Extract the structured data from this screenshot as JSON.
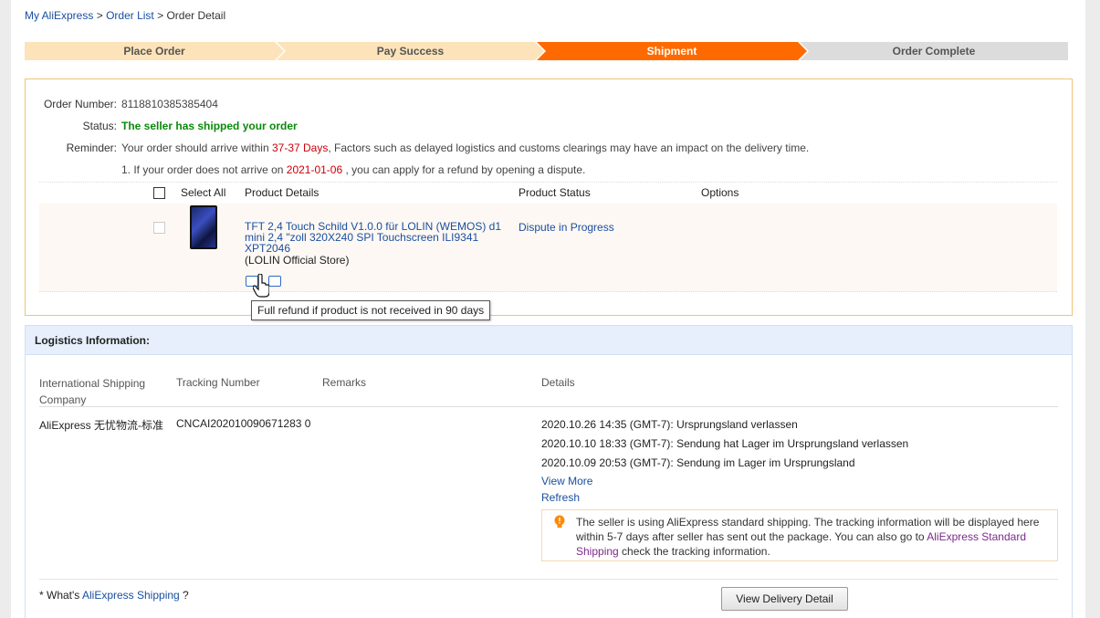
{
  "breadcrumb": {
    "home": "My AliExpress",
    "sep1": ">",
    "list": "Order List",
    "sep2": ">",
    "current": "Order Detail"
  },
  "steps": [
    "Place Order",
    "Pay Success",
    "Shipment",
    "Order Complete"
  ],
  "active_step_color": "#ff6a00",
  "order": {
    "number_label": "Order Number:",
    "number": "8118810385385404",
    "status_label": "Status:",
    "status": "The seller has shipped your order",
    "reminder_label": "Reminder:",
    "reminder_pre": "Your order should arrive within ",
    "reminder_days": "37-37 Days",
    "reminder_post": ", Factors such as delayed logistics and customs clearings may have an impact on the delivery time.",
    "note_pre": "1. If your order does not arrive on ",
    "note_date": "2021-01-06",
    "note_post": " , you can apply for a refund by opening a dispute."
  },
  "table": {
    "select_all": "Select All",
    "col_product": "Product Details",
    "col_status": "Product Status",
    "col_options": "Options"
  },
  "product": {
    "title_line1": "TFT 2,4 Touch Schild V1.0.0 für LOLIN (WEMOS) d1",
    "title_line2": "mini 2,4 \"zoll 320X240 SPI Touchscreen ILI9341",
    "title_line3": "XPT2046",
    "store": "(LOLIN Official Store)",
    "status": "Dispute in Progress"
  },
  "tooltip": "Full refund if product is not received in 90 days",
  "logistics": {
    "header": "Logistics Information:",
    "col_company_1": "International Shipping",
    "col_company_2": "Company",
    "col_tracking": "Tracking Number",
    "col_remarks": "Remarks",
    "col_details": "Details",
    "company": "AliExpress 无忧物流-标准",
    "tracking": "CNCAI202010090671283 0",
    "events": [
      "2020.10.26 14:35 (GMT-7): Ursprungsland verlassen",
      "2020.10.10 18:33 (GMT-7): Sendung hat Lager im Ursprungsland verlassen",
      "2020.10.09 20:53 (GMT-7): Sendung im Lager im Ursprungsland"
    ],
    "view_more": "View More",
    "refresh": "Refresh",
    "notice_pre": "The seller is using AliExpress standard shipping. The tracking information will be displayed here within 5-7 days after seller has sent out the package. You can also go to ",
    "notice_link": "AliExpress Standard Shipping",
    "notice_post": " check the tracking information.",
    "whats_pre": "* What's ",
    "whats_link": "AliExpress Shipping",
    "whats_post": " ?",
    "view_delivery": "View Delivery Detail"
  }
}
